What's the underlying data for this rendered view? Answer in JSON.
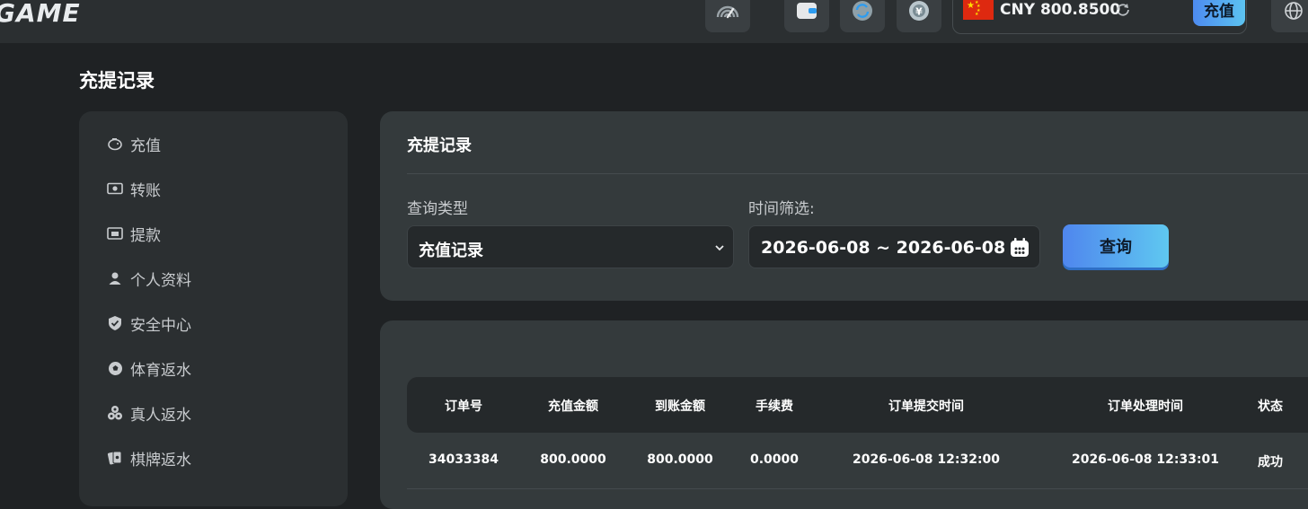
{
  "header": {
    "logo": "GAME",
    "balance": {
      "currency": "CNY",
      "amount": "800.8500"
    },
    "recharge_label": "充值",
    "colors": {
      "accent_start": "#4d8bf0",
      "accent_end": "#5cc3f0",
      "flag": "#de2910"
    },
    "icons": [
      "speed-icon",
      "wallet-icon",
      "refresh-icon",
      "yen-coin-icon",
      "globe-icon"
    ]
  },
  "page": {
    "title": "充提记录"
  },
  "sidebar": {
    "items": [
      {
        "label": "充值",
        "icon": "piggy-bank-icon"
      },
      {
        "label": "转账",
        "icon": "money-icon"
      },
      {
        "label": "提款",
        "icon": "cash-out-icon"
      },
      {
        "label": "个人资料",
        "icon": "user-icon"
      },
      {
        "label": "安全中心",
        "icon": "shield-icon"
      },
      {
        "label": "体育返水",
        "icon": "soccer-ball-icon"
      },
      {
        "label": "真人返水",
        "icon": "chips-icon"
      },
      {
        "label": "棋牌返水",
        "icon": "cards-icon"
      }
    ]
  },
  "filter": {
    "title": "充提记录",
    "type_label": "查询类型",
    "type_value": "充值记录",
    "time_label": "时间筛选:",
    "date_range": "2026-06-08 ~ 2026-06-08",
    "query_label": "查询"
  },
  "table": {
    "headers": [
      "订单号",
      "充值金额",
      "到账金额",
      "手续费",
      "订单提交时间",
      "订单处理时间",
      "状态"
    ],
    "rows": [
      [
        "34033384",
        "800.0000",
        "800.0000",
        "0.0000",
        "2026-06-08 12:32:00",
        "2026-06-08 12:33:01",
        "成功"
      ]
    ]
  }
}
